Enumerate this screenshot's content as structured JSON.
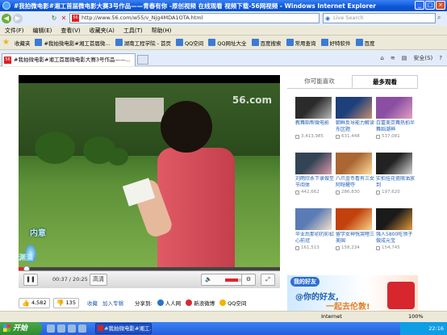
{
  "window": {
    "title": "#我拍微电影#湘工首届微电影大赛3号作品——青春有你 -原创视频 在线观看 视频下载-56网视频 - Windows Internet Explorer"
  },
  "addressbar": {
    "url": "http://www.56.com/w55/v_Njg4MDA1OTA.html",
    "search_placeholder": "Live Search"
  },
  "menu": [
    "文件(F)",
    "编辑(E)",
    "查看(V)",
    "收藏夹(A)",
    "工具(T)",
    "帮助(H)"
  ],
  "favorites": {
    "label": "收藏夹",
    "items": [
      "#我拍微电影#湘工首届微...",
      "湖南工程学院 - 首页",
      "QQ空间",
      "QQ网址大全",
      "百度搜索",
      "常用查询",
      "好特软件",
      "百度"
    ]
  },
  "tab": {
    "label": "#我拍微电影#湘工首届微电影大赛3号作品——...",
    "tools": [
      "安全(S)",
      "?"
    ]
  },
  "player": {
    "logo": "56.com",
    "caption_top": "内意",
    "caption_bottom": "渊漠",
    "time": "00:37 / 20:25",
    "quality_label": "高清",
    "progress": 0.03,
    "volume": 0.65
  },
  "stats": {
    "likes": "4,582",
    "dislikes": "135",
    "favorite_label": "收藏",
    "add_album_label": "加入专辑",
    "share_label": "分享到:",
    "share_targets": [
      {
        "name": "人人网",
        "color": "#2a73c9"
      },
      {
        "name": "新浪微博",
        "color": "#d9272e"
      },
      {
        "name": "QQ空间",
        "color": "#f0b400"
      }
    ]
  },
  "sidebar": {
    "tabs": [
      "你可能喜欢",
      "最多观看"
    ],
    "active_tab": 1,
    "videos": [
      {
        "title": "教舞蹈帮微电影",
        "views": "3,413,985"
      },
      {
        "title": "朝鲜反导能力解读东区题",
        "views": "631,448"
      },
      {
        "title": "白富美京舞热拍半舞蹈潮神",
        "views": "537,081"
      },
      {
        "title": "刘雨欣永下录做至节阅体",
        "views": "442,662"
      },
      {
        "title": "八爪金币看有三女阿呀醒夺",
        "views": "286,830"
      },
      {
        "title": "实拍挂花瓷限油放到",
        "views": "197,620"
      },
      {
        "title": "毕业后那初的彩虹心前冠",
        "views": "161,513"
      },
      {
        "title": "留学女神恍哭哩三美国",
        "views": "158,234"
      },
      {
        "title": "强人5800吃领子做成元宝",
        "views": "154,745"
      }
    ]
  },
  "ad": {
    "line1": "我的好友",
    "line2": "@你的好友,",
    "line3": "一起去伦敦!"
  },
  "statusbar": {
    "zone": "Internet",
    "zoom": "100%"
  },
  "taskbar": {
    "start_label": "开始",
    "task_label": "#我拍微电影#湘工...",
    "clock": "22:16"
  }
}
